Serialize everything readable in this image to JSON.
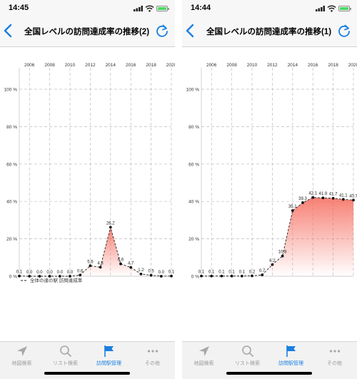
{
  "screens": [
    {
      "status": {
        "time": "14:45"
      },
      "nav": {
        "title": "全国レベルの訪問達成率の推移(2)"
      },
      "chart_data": {
        "type": "line",
        "x": [
          2005,
          2006,
          2007,
          2008,
          2009,
          2010,
          2011,
          2012,
          2013,
          2014,
          2015,
          2016,
          2017,
          2018,
          2019,
          2020
        ],
        "values": [
          0.1,
          0.0,
          0.0,
          0.0,
          0.0,
          0.0,
          0.6,
          5.6,
          4.8,
          26.2,
          6.6,
          4.7,
          1.2,
          0.5,
          0.0,
          0.1
        ],
        "point_labels": [
          "0.1",
          "0.0",
          "0.0",
          "0.0",
          "0.0",
          "0.0",
          "0.6",
          "5.6",
          "4.8",
          "26.2",
          "6.6",
          "4.7",
          "1.2",
          "0.5",
          "0.0",
          "0.1"
        ],
        "xticks": [
          "2006",
          "2008",
          "2010",
          "2012",
          "2014",
          "2016",
          "2018",
          "2020"
        ],
        "xtick_values": [
          2006,
          2008,
          2010,
          2012,
          2014,
          2016,
          2018,
          2020
        ],
        "yticks": [
          "0 %",
          "20 %",
          "40 %",
          "60 %",
          "80 %",
          "100 %"
        ],
        "ylim": [
          0,
          100
        ],
        "xlim": [
          2005,
          2020
        ],
        "legend": "全体の達の駅 訪問達成率",
        "grid": true,
        "fill_color": "#f56a5c",
        "line_color": "#222222"
      },
      "tabs": [
        {
          "label": "地図検索",
          "icon": "location-arrow-icon",
          "active": false
        },
        {
          "label": "リスト検索",
          "icon": "magnifier-icon",
          "active": false
        },
        {
          "label": "訪問駅管理",
          "icon": "flag-icon",
          "active": true
        },
        {
          "label": "その他",
          "icon": "more-icon",
          "active": false
        }
      ]
    },
    {
      "status": {
        "time": "14:44"
      },
      "nav": {
        "title": "全国レベルの訪問達成率の推移(1)"
      },
      "chart_data": {
        "type": "line",
        "x": [
          2005,
          2006,
          2007,
          2008,
          2009,
          2010,
          2011,
          2012,
          2013,
          2014,
          2015,
          2016,
          2017,
          2018,
          2019,
          2020
        ],
        "values": [
          0.1,
          0.1,
          0.1,
          0.1,
          0.1,
          0.2,
          0.7,
          6.2,
          10.8,
          35.1,
          39.3,
          42.1,
          41.9,
          41.7,
          41.1,
          40.7
        ],
        "point_labels": [
          "0.1",
          "0.1",
          "0.1",
          "0.1",
          "0.1",
          "0.2",
          "0.7",
          "6.2",
          "10.8",
          "35.1",
          "39.3",
          "42.1",
          "41.9",
          "41.7",
          "41.1",
          "40.7"
        ],
        "xticks": [
          "2006",
          "2008",
          "2010",
          "2012",
          "2014",
          "2016",
          "2018",
          "2020"
        ],
        "xtick_values": [
          2006,
          2008,
          2010,
          2012,
          2014,
          2016,
          2018,
          2020
        ],
        "yticks": [
          "0 %",
          "20 %",
          "40 %",
          "60 %",
          "80 %",
          "100 %"
        ],
        "ylim": [
          0,
          100
        ],
        "xlim": [
          2005,
          2020
        ],
        "legend": "",
        "grid": true,
        "fill_color": "#f56a5c",
        "line_color": "#222222"
      },
      "tabs": [
        {
          "label": "地図検索",
          "icon": "location-arrow-icon",
          "active": false
        },
        {
          "label": "リスト検索",
          "icon": "magnifier-icon",
          "active": false
        },
        {
          "label": "訪問駅管理",
          "icon": "flag-icon",
          "active": true
        },
        {
          "label": "その他",
          "icon": "more-icon",
          "active": false
        }
      ]
    }
  ]
}
